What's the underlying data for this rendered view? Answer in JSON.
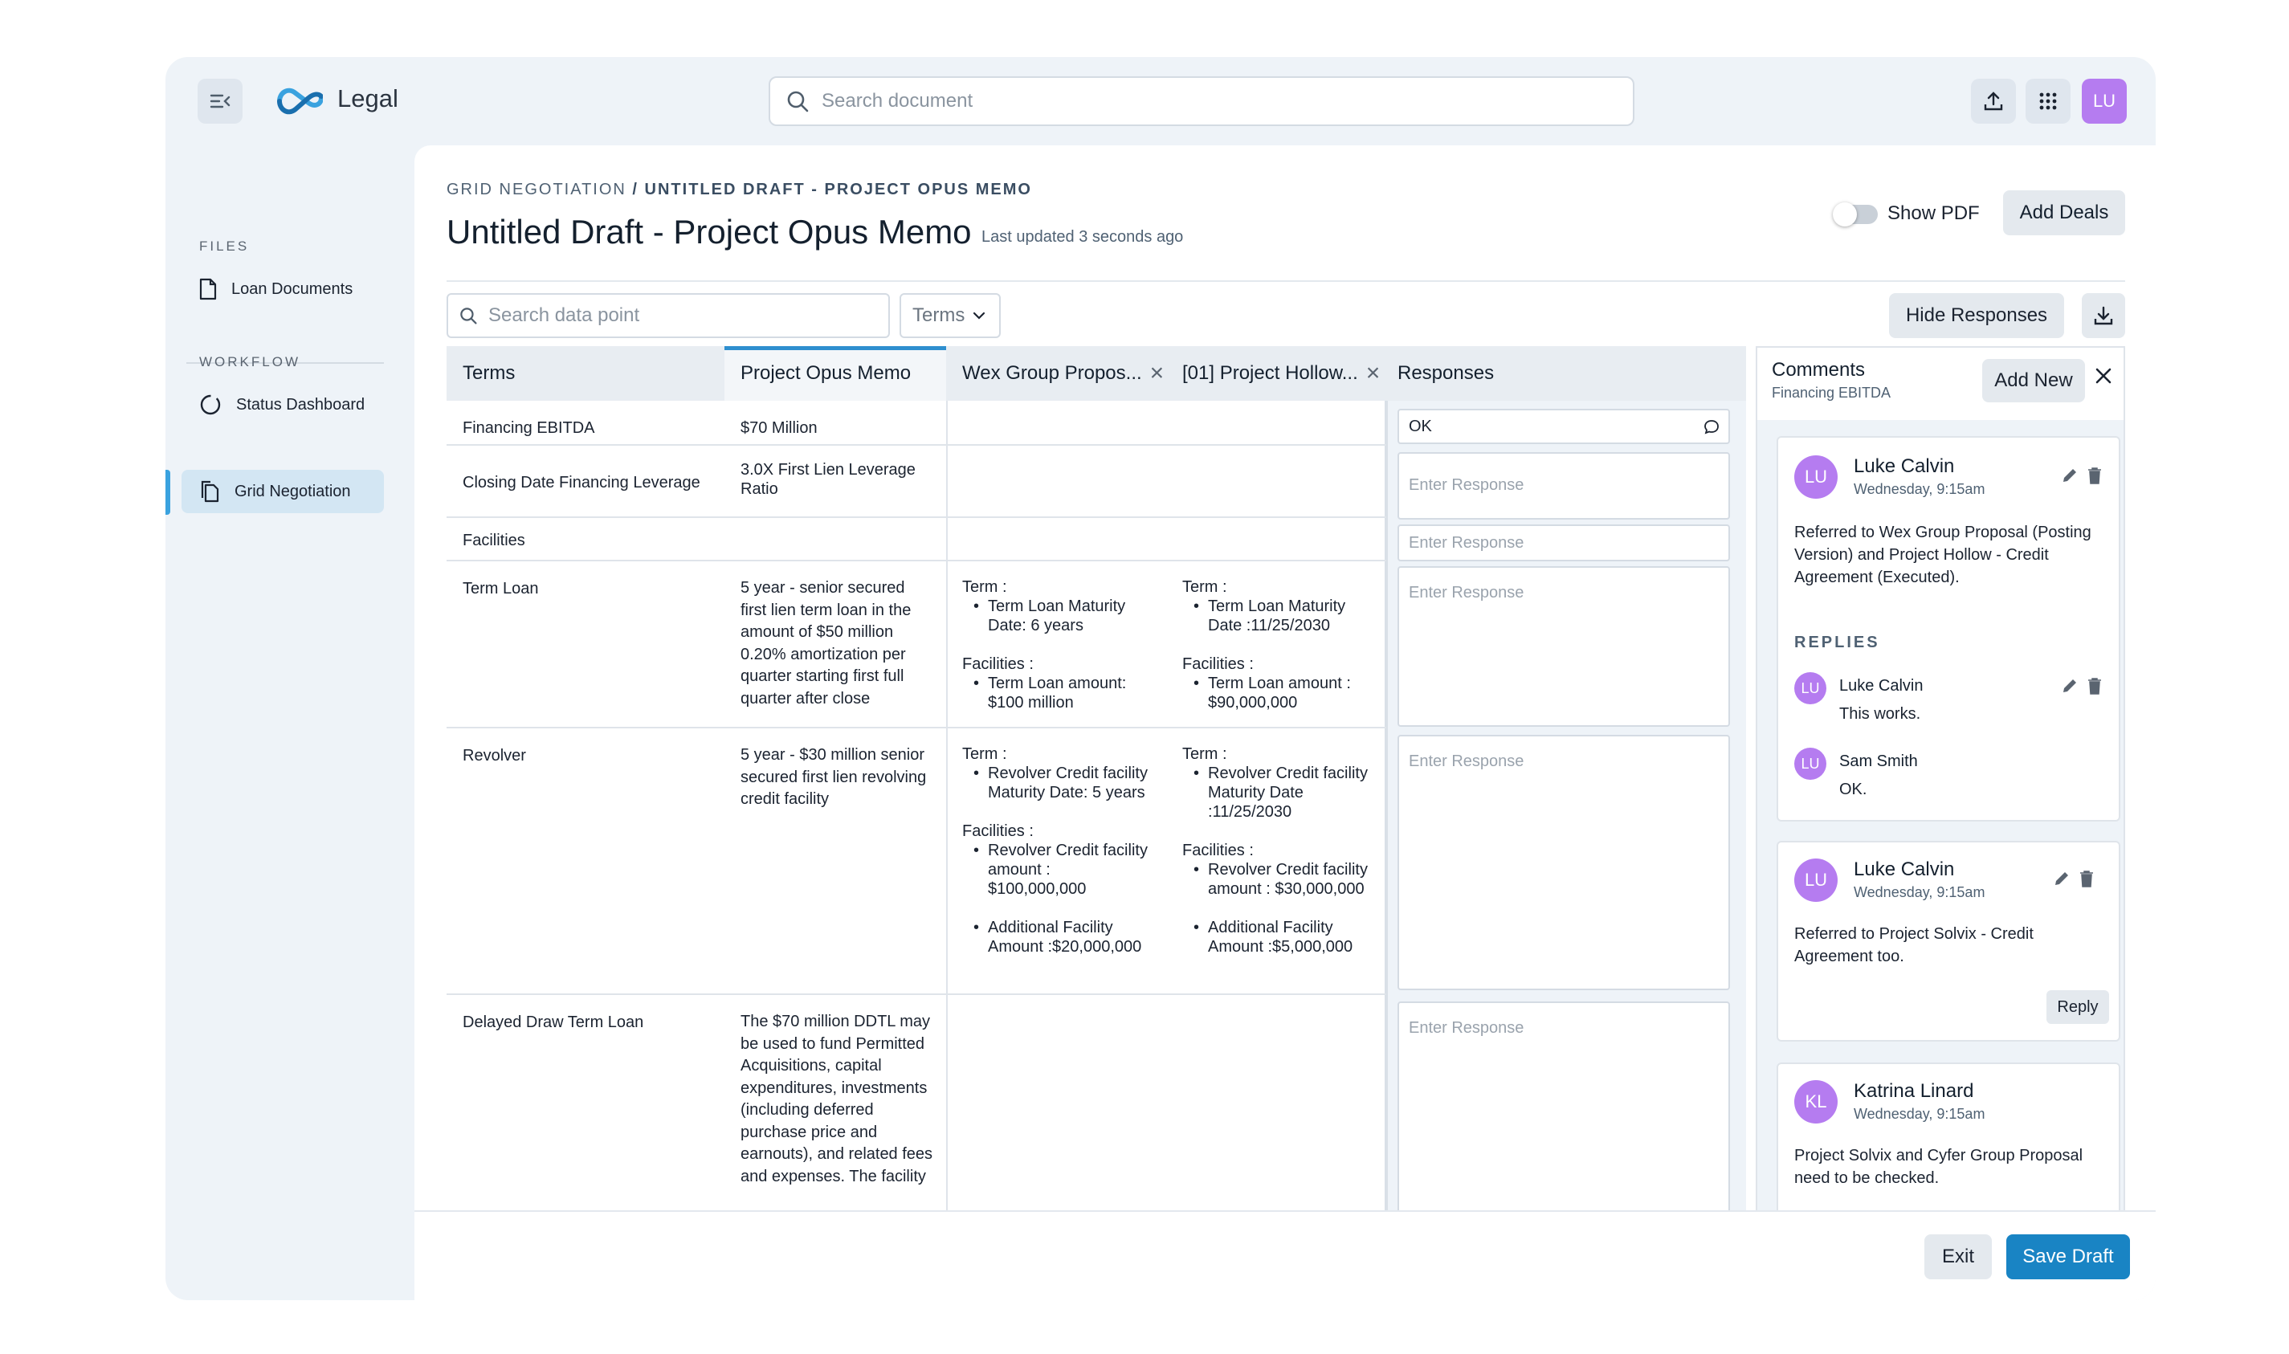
{
  "app": {
    "name": "Legal",
    "avatar_initials": "LU"
  },
  "search": {
    "placeholder": "Search document"
  },
  "sidebar": {
    "files_label": "FILES",
    "files_items": [
      {
        "label": "Loan Documents",
        "icon": "document-icon"
      }
    ],
    "workflow_label": "WORKFLOW",
    "workflow_items": [
      {
        "label": "Status Dashboard",
        "icon": "progress-circle-icon"
      },
      {
        "label": "Grid Negotiation",
        "icon": "copy-document-icon",
        "active": true
      }
    ]
  },
  "header": {
    "breadcrumb_parent": "GRID NEGOTIATION",
    "breadcrumb_sep": " / ",
    "breadcrumb_current": "UNTITLED DRAFT - PROJECT OPUS MEMO",
    "title": "Untitled Draft - Project Opus Memo",
    "updated": "Last updated 3 seconds ago",
    "show_pdf_label": "Show PDF",
    "show_pdf_on": false,
    "add_deals_label": "Add Deals"
  },
  "toolbar": {
    "search_placeholder": "Search data point",
    "filter_value": "Terms",
    "hide_responses_label": "Hide Responses"
  },
  "grid": {
    "columns": [
      "Terms",
      "Project Opus Memo",
      "Wex Group Propos...",
      "[01] Project Hollow...",
      "Responses"
    ],
    "rows": [
      {
        "term": "Financing EBITDA",
        "opus": "$70 Million",
        "response": "OK"
      },
      {
        "term": "Closing Date Financing Leverage",
        "opus": "3.0X First Lien Leverage Ratio",
        "response": ""
      },
      {
        "term": "Facilities",
        "opus": "",
        "response": ""
      },
      {
        "term": "Term Loan",
        "opus": "5 year - senior secured first lien term loan in the amount of $50 million 0.20% amortization per quarter starting first full quarter after close",
        "response": "",
        "wex": {
          "term_label": "Term :",
          "term_items": [
            "Term Loan Maturity Date: 6 years"
          ],
          "fac_label": "Facilities :",
          "fac_items": [
            "Term Loan amount: $100 million"
          ]
        },
        "hollow": {
          "term_label": "Term :",
          "term_items": [
            "Term Loan Maturity Date :11/25/2030"
          ],
          "fac_label": "Facilities :",
          "fac_items": [
            "Term Loan amount : $90,000,000"
          ]
        }
      },
      {
        "term": "Revolver",
        "opus": "5 year - $30 million senior secured first lien revolving credit facility",
        "response": "",
        "wex": {
          "term_label": "Term :",
          "term_items": [
            "Revolver Credit facility Maturity Date: 5 years"
          ],
          "fac_label": "Facilities :",
          "fac_items": [
            "Revolver Credit facility amount : $100,000,000",
            "Additional Facility Amount :$20,000,000"
          ]
        },
        "hollow": {
          "term_label": "Term :",
          "term_items": [
            "Revolver Credit facility Maturity Date :11/25/2030"
          ],
          "fac_label": "Facilities :",
          "fac_items": [
            "Revolver Credit facility amount : $30,000,000",
            "Additional Facility Amount :$5,000,000"
          ]
        }
      },
      {
        "term": "Delayed Draw Term Loan",
        "opus": "The $70 million DDTL may be used to fund Permitted Acquisitions, capital expenditures, investments (including deferred purchase price and earnouts), and related fees and expenses. The facility",
        "response": ""
      }
    ],
    "response_placeholder": "Enter Response"
  },
  "comments": {
    "title": "Comments",
    "subtitle": "Financing EBITDA",
    "add_new_label": "Add New",
    "replies_label": "REPLIES",
    "reply_label": "Reply",
    "items": [
      {
        "initials": "LU",
        "author": "Luke Calvin",
        "time": "Wednesday, 9:15am",
        "text": "Referred to Wex Group Proposal (Posting Version) and Project Hollow - Credit Agreement (Executed).",
        "replies": [
          {
            "initials": "LU",
            "author": "Luke Calvin",
            "text": "This works."
          },
          {
            "initials": "LU",
            "author": "Sam Smith",
            "text": "OK."
          }
        ]
      },
      {
        "initials": "LU",
        "author": "Luke Calvin",
        "time": "Wednesday, 9:15am",
        "text": "Referred to Project Solvix - Credit Agreement too."
      },
      {
        "initials": "KL",
        "author": "Katrina Linard",
        "time": "Wednesday, 9:15am",
        "text": "Project Solvix and Cyfer Group Proposal need to be checked."
      }
    ]
  },
  "footer": {
    "exit_label": "Exit",
    "save_label": "Save Draft"
  },
  "colors": {
    "accent": "#1984c4",
    "avatar": "#b57cf0",
    "active_nav": "#d3e6f3",
    "tab_underline": "#2e8fcf"
  }
}
